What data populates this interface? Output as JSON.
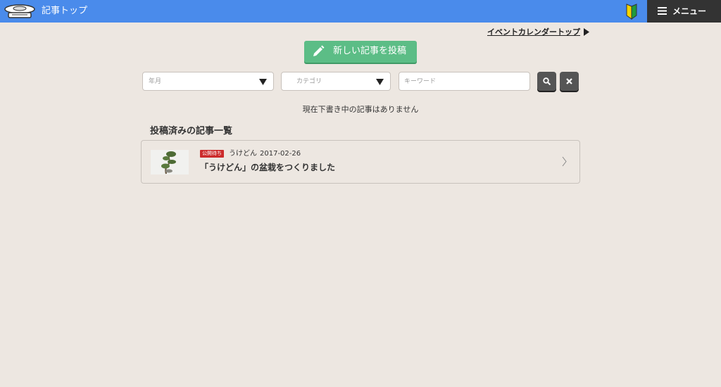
{
  "header": {
    "title": "記事トップ",
    "menu_label": "メニュー",
    "logo_icon": "mushroom-logo-icon",
    "beginner_icon": "beginner-mark-icon"
  },
  "calendar_link": {
    "label": "イベントカレンダートップ"
  },
  "post_button": {
    "label": "新しい記事を投稿"
  },
  "filters": {
    "month_placeholder": "年月",
    "category_placeholder": "カテゴリ",
    "keyword_placeholder": "キーワード"
  },
  "no_draft_message": "現在下書き中の記事はありません",
  "list": {
    "title": "投稿済みの記事一覧",
    "items": [
      {
        "status": "公開待ち",
        "author": "うけどん",
        "date": "2017-02-26",
        "title": "「うけどん」の盆栽をつくりました"
      }
    ]
  },
  "colors": {
    "header_bg": "#4a8beb",
    "menu_bg": "#333333",
    "page_bg": "#ede7e1",
    "post_button": "#5cbd86",
    "status_badge": "#cc2b2b"
  }
}
